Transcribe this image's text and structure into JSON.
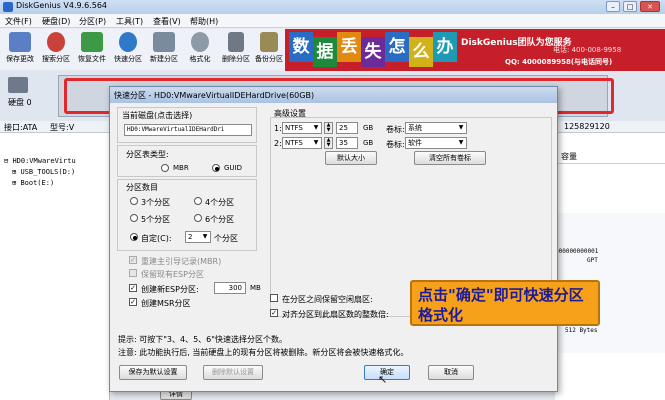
{
  "app": {
    "title": "DiskGenius V4.9.6.564"
  },
  "menu": [
    "文件(F)",
    "硬盘(D)",
    "分区(P)",
    "工具(T)",
    "查看(V)",
    "帮助(H)"
  ],
  "toolbar": [
    "保存更改",
    "搜索分区",
    "恢复文件",
    "快速分区",
    "新建分区",
    "格式化",
    "删除分区",
    "备份分区"
  ],
  "banner": {
    "tiles": [
      "数",
      "据",
      "丢",
      "失",
      "怎",
      "么",
      "办"
    ],
    "brand": "DiskGenius团队为您服务",
    "phone": "电话: 400-008-9958",
    "qq": "QQ: 4000089958(与电话同号)"
  },
  "diskbar": {
    "disk_label": "硬盘 0"
  },
  "infobar": {
    "iface": "接口:ATA",
    "model": "型号:V",
    "sectors": "125829120"
  },
  "tree": [
    {
      "label": "HD0:VMwareVirtu"
    },
    {
      "label": "USB_TOOLS(D:)"
    },
    {
      "label": "Boot(E:)"
    }
  ],
  "rightpane": {
    "header": "容量",
    "hex": "000000000001",
    "gpt": "GPT",
    "bytes": "512 Bytes"
  },
  "dialog": {
    "title": "快速分区 - HD0:VMwareVirtualIDEHardDrive(60GB)",
    "current_disk_label": "当前磁盘(点击选择)",
    "current_disk_value": "HD0:VMwareVirtualIDEHardDri",
    "table_type_label": "分区表类型:",
    "mbr": "MBR",
    "guid": "GUID",
    "count_label": "分区数目",
    "counts": [
      "3个分区",
      "4个分区",
      "5个分区",
      "6个分区"
    ],
    "custom_label": "自定(C):",
    "custom_value": "2",
    "custom_suffix": "个分区",
    "rebuild_mbr": "重建主引导记录(MBR)",
    "keep_esp": "保留现有ESP分区",
    "create_esp": "创建新ESP分区:",
    "esp_size": "300",
    "esp_unit": "MB",
    "create_msr": "创建MSR分区",
    "advanced_label": "高级设置",
    "partitions": [
      {
        "index": "1:",
        "fs": "NTFS",
        "size": "25",
        "unit": "GB",
        "vol_label": "卷标:",
        "volume": "系统"
      },
      {
        "index": "2:",
        "fs": "NTFS",
        "size": "35",
        "unit": "GB",
        "vol_label": "卷标:",
        "volume": "软件"
      }
    ],
    "default_size_btn": "默认大小",
    "clear_labels_btn": "清空所有卷标",
    "keep_free": "在分区之间保留空闲扇区:",
    "align": "对齐分区到此扇区数的整数倍:",
    "hint": "提示: 可按下\"3、4、5、6\"快速选择分区个数。",
    "note": "注意: 此功能执行后, 当前硬盘上的现有分区将被删除。新分区将会被快速格式化。",
    "save_settings_btn": "保存为默认设置",
    "delete_settings_btn": "删除默认设置",
    "ok_btn": "确定",
    "cancel_btn": "取消"
  },
  "details_tab": "详情",
  "tooltip": "点击\"确定\"即可快速分区格式化"
}
